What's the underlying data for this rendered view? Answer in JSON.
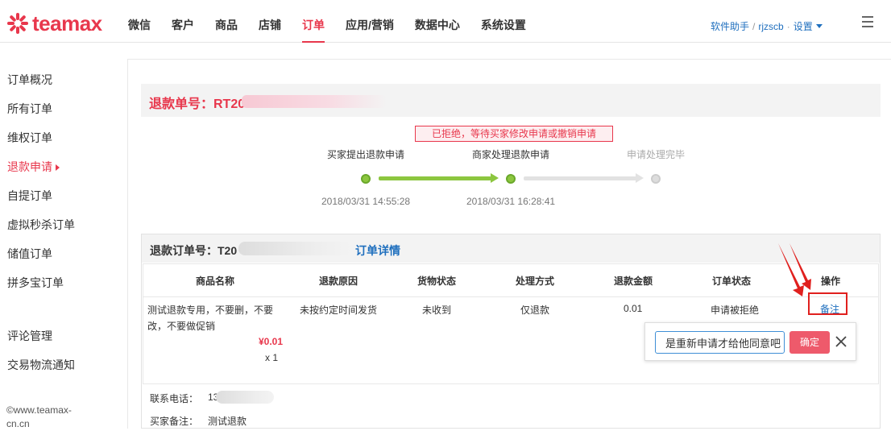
{
  "brand": {
    "name": "teamax",
    "color": "#e8374c"
  },
  "nav": {
    "items": [
      "微信",
      "客户",
      "商品",
      "店铺",
      "订单",
      "应用/营销",
      "数据中心",
      "系统设置"
    ],
    "active": "订单"
  },
  "user": {
    "helper": "软件助手",
    "separator": "/",
    "account": "rjzscb",
    "dot": "·",
    "settings": "设置"
  },
  "sidebar": {
    "items": [
      "订单概况",
      "所有订单",
      "维权订单",
      "退款申请",
      "自提订单",
      "虚拟秒杀订单",
      "储值订单",
      "拼多宝订单"
    ],
    "active": "退款申请",
    "extra": [
      "评论管理",
      "交易物流通知"
    ],
    "copyright": "©www.teamax-cn.cn"
  },
  "refund": {
    "title": "退款单号：RT20"
  },
  "progress": {
    "status": "已拒绝，等待买家修改申请或撤销申请",
    "steps": [
      {
        "label": "买家提出退款申请",
        "time": "2018/03/31 14:55:28",
        "done": true
      },
      {
        "label": "商家处理退款申请",
        "time": "2018/03/31 16:28:41",
        "done": true
      },
      {
        "label": "申请处理完毕",
        "time": "",
        "done": false
      }
    ]
  },
  "order": {
    "title": "退款订单号：T20",
    "detail_link": "订单详情",
    "columns": [
      "商品名称",
      "退款原因",
      "货物状态",
      "处理方式",
      "退款金额",
      "订单状态",
      "操作"
    ],
    "row": {
      "product": "测试退款专用，不要删，不要改，不要做促销",
      "price": "¥0.01",
      "qty": "x 1",
      "reason": "未按约定时间发货",
      "goods_status": "未收到",
      "method": "仅退款",
      "amount": "0.01",
      "order_status": "申请被拒绝",
      "action": "备注"
    },
    "contact_label": "联系电话：",
    "contact_value": "13",
    "buyer_note_label": "买家备注：",
    "buyer_note_value": "测试退款"
  },
  "popover": {
    "input_value": "是重新申请才给他同意吧",
    "confirm": "确定"
  }
}
